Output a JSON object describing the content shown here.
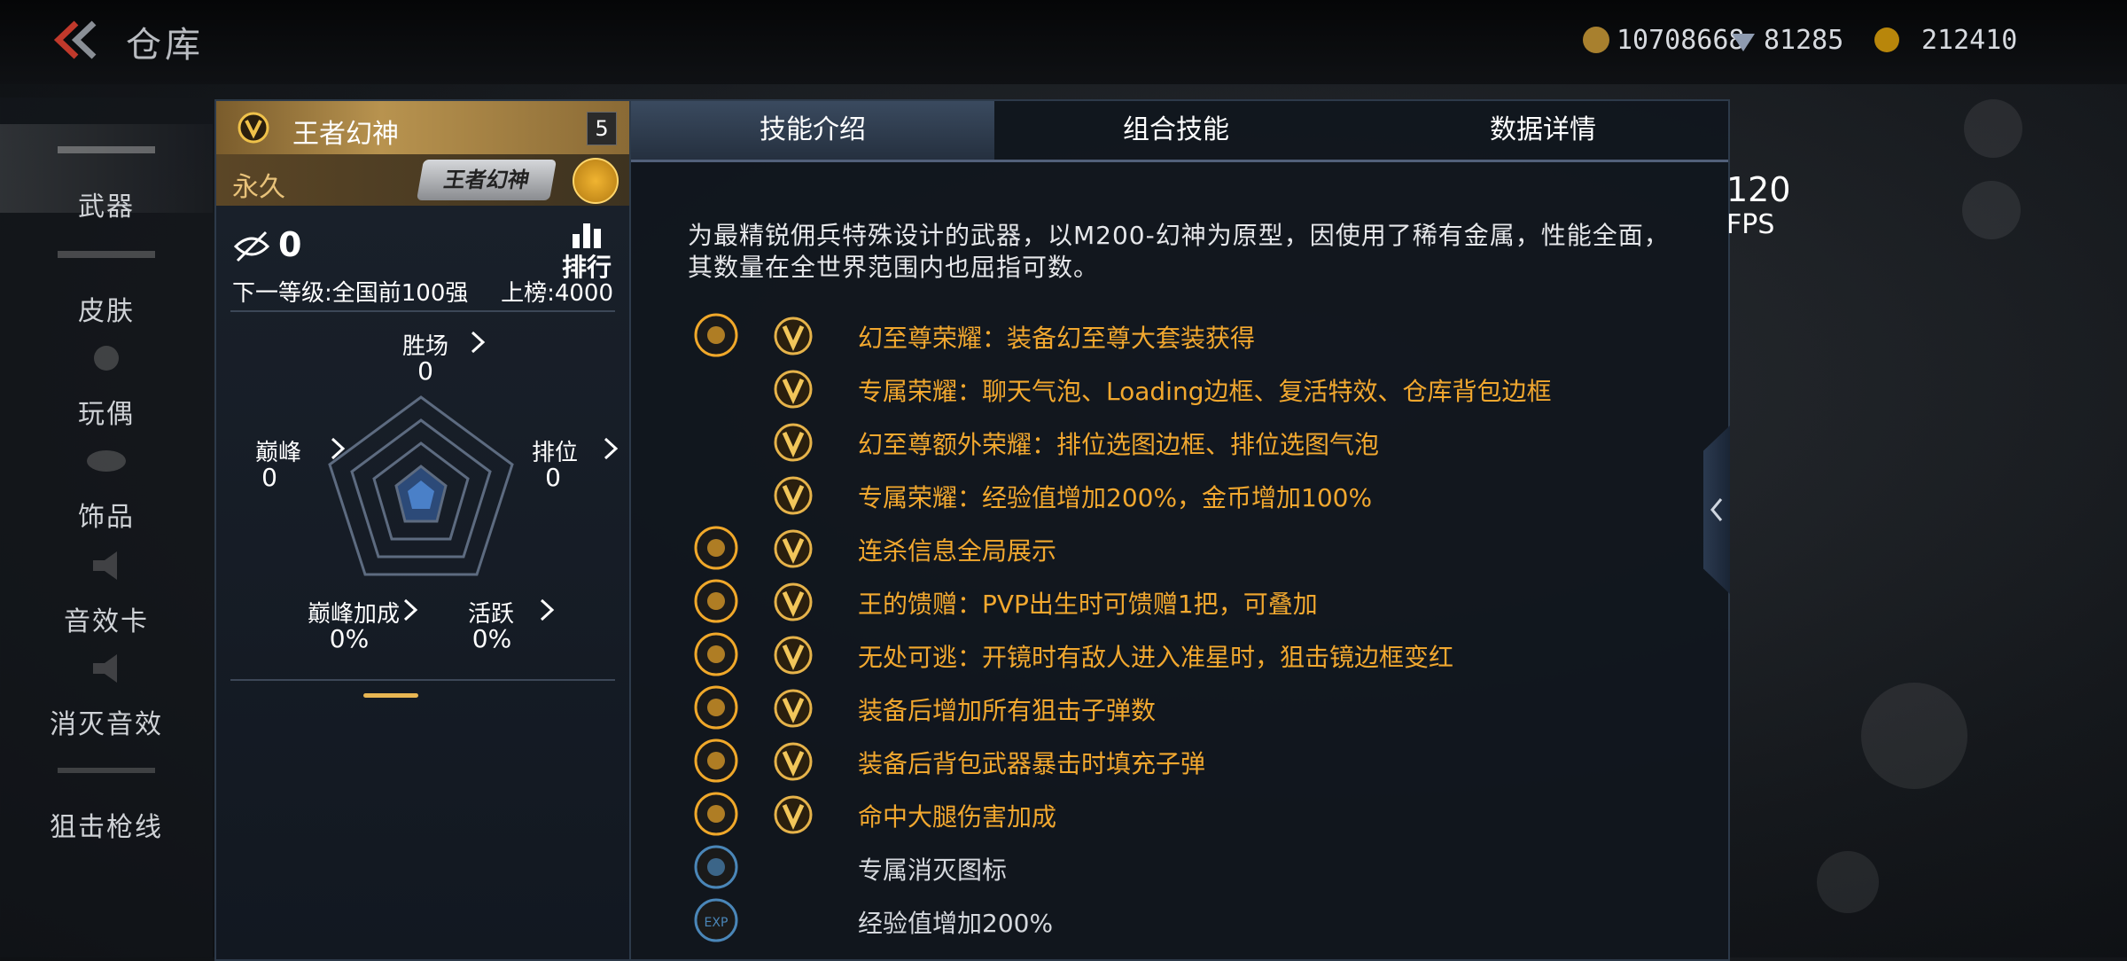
{
  "header": {
    "title": "仓库",
    "currencies": [
      {
        "icon": "coin-icon",
        "value": "10708668"
      },
      {
        "icon": "diamond-icon",
        "value": "81285"
      },
      {
        "icon": "gold-icon",
        "value": "212410"
      }
    ]
  },
  "sidebar": {
    "items": [
      {
        "label": "武器",
        "active": true
      },
      {
        "label": "皮肤"
      },
      {
        "label": "玩偶"
      },
      {
        "label": "饰品"
      },
      {
        "label": "音效卡"
      },
      {
        "label": "消灭音效"
      },
      {
        "label": "狙击枪线"
      }
    ]
  },
  "card": {
    "name": "王者幻神",
    "level": "5",
    "duration": "永久",
    "logo_text": "王者幻神",
    "rank_value": "0",
    "rank_label": "排行",
    "next_level": "下一等级:全国前100强",
    "board": "上榜:4000",
    "radar": {
      "wins": {
        "label": "胜场",
        "value": "0"
      },
      "peak": {
        "label": "巅峰",
        "value": "0"
      },
      "ranked": {
        "label": "排位",
        "value": "0"
      },
      "peak_bonus": {
        "label": "巅峰加成",
        "value": "0%"
      },
      "active": {
        "label": "活跃",
        "value": "0%"
      }
    }
  },
  "tabs": [
    {
      "label": "技能介绍",
      "active": true
    },
    {
      "label": "组合技能"
    },
    {
      "label": "数据详情"
    }
  ],
  "description": "为最精锐佣兵特殊设计的武器，以M200-幻神为原型，因使用了稀有金属，性能全面，其数量在全世界范围内也屈指可数。",
  "skills": [
    {
      "icon": "diamond-pattern-icon",
      "v": true,
      "text": "幻至尊荣耀：装备幻至尊大套装获得",
      "grey": false
    },
    {
      "icon": "",
      "v": true,
      "text": "专属荣耀：聊天气泡、Loading边框、复活特效、仓库背包边框",
      "grey": false
    },
    {
      "icon": "",
      "v": true,
      "text": "幻至尊额外荣耀：排位选图边框、排位选图气泡",
      "grey": false
    },
    {
      "icon": "",
      "v": true,
      "text": "专属荣耀：经验值增加200%，金币增加100%",
      "grey": false
    },
    {
      "icon": "kill-info-icon",
      "v": true,
      "text": "连杀信息全局展示",
      "grey": false
    },
    {
      "icon": "gift-icon",
      "v": true,
      "text": "王的馈赠：PVP出生时可馈赠1把，可叠加",
      "grey": false
    },
    {
      "icon": "scope-icon",
      "v": true,
      "text": "无处可逃：开镜时有敌人进入准星时，狙击镜边框变红",
      "grey": false
    },
    {
      "icon": "pistol-icon",
      "v": true,
      "text": "装备后增加所有狙击子弹数",
      "grey": false
    },
    {
      "icon": "backpack-icon",
      "v": true,
      "text": "装备后背包武器暴击时填充子弹",
      "grey": false
    },
    {
      "icon": "leg-hit-icon",
      "v": true,
      "text": "命中大腿伤害加成",
      "grey": false
    },
    {
      "icon": "kill-badge-icon",
      "v": false,
      "text": "专属消灭图标",
      "grey": true
    },
    {
      "icon": "exp-icon",
      "v": false,
      "text": "经验值增加200%",
      "grey": true
    }
  ],
  "fps": {
    "value": "120",
    "unit": "FPS"
  }
}
